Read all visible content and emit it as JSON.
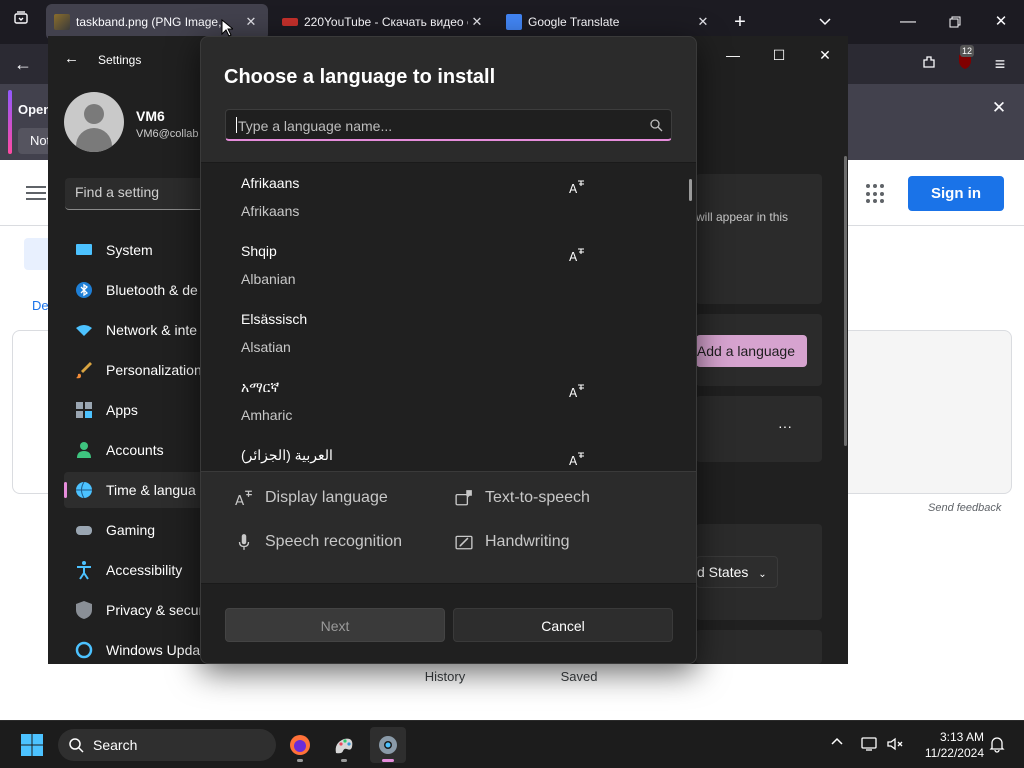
{
  "browser": {
    "tabs": [
      {
        "title": "taskband.png (PNG Image,",
        "active": true
      },
      {
        "title": "220YouTube - Скачать видео с",
        "active": false
      },
      {
        "title": "Google Translate",
        "active": false
      }
    ],
    "notif_bar": {
      "heading": "Open",
      "button": "Not"
    }
  },
  "google_page": {
    "sign_in": "Sign in",
    "send_feedback": "Send feedback",
    "tab_label": "De",
    "history_label": "History",
    "saved_label": "Saved"
  },
  "settings": {
    "header": "Settings",
    "user": {
      "name": "VM6",
      "email": "VM6@collab"
    },
    "find_placeholder": "Find a setting",
    "nav": [
      {
        "label": "System",
        "icon": "system-icon"
      },
      {
        "label": "Bluetooth & de",
        "icon": "bluetooth-icon"
      },
      {
        "label": "Network & inte",
        "icon": "network-icon"
      },
      {
        "label": "Personalization",
        "icon": "brush-icon"
      },
      {
        "label": "Apps",
        "icon": "apps-icon"
      },
      {
        "label": "Accounts",
        "icon": "accounts-icon"
      },
      {
        "label": "Time & langua",
        "icon": "time-language-icon",
        "selected": true
      },
      {
        "label": "Gaming",
        "icon": "gaming-icon"
      },
      {
        "label": "Accessibility",
        "icon": "accessibility-icon"
      },
      {
        "label": "Privacy & secur",
        "icon": "shield-icon"
      },
      {
        "label": "Windows Upda",
        "icon": "update-icon"
      }
    ],
    "right_fragments": {
      "appear_text": "will appear in this",
      "add_language": "Add a language",
      "region_text": "d States",
      "more": "···"
    }
  },
  "dialog": {
    "title": "Choose a language to install",
    "search_placeholder": "Type a language name...",
    "languages": [
      {
        "native": "Afrikaans",
        "english": "Afrikaans",
        "display_language": true
      },
      {
        "native": "Shqip",
        "english": "Albanian",
        "display_language": true
      },
      {
        "native": "Elsässisch",
        "english": "Alsatian",
        "display_language": false
      },
      {
        "native": "አማርኛ",
        "english": "Amharic",
        "display_language": true
      },
      {
        "native": "العربية (الجزائر)",
        "english": "",
        "display_language": true
      }
    ],
    "features": {
      "display_language": "Display language",
      "text_to_speech": "Text-to-speech",
      "speech_recognition": "Speech recognition",
      "handwriting": "Handwriting"
    },
    "next": "Next",
    "cancel": "Cancel"
  },
  "taskbar": {
    "search": "Search",
    "time": "3:13 AM",
    "date": "11/22/2024",
    "badge": "12"
  }
}
